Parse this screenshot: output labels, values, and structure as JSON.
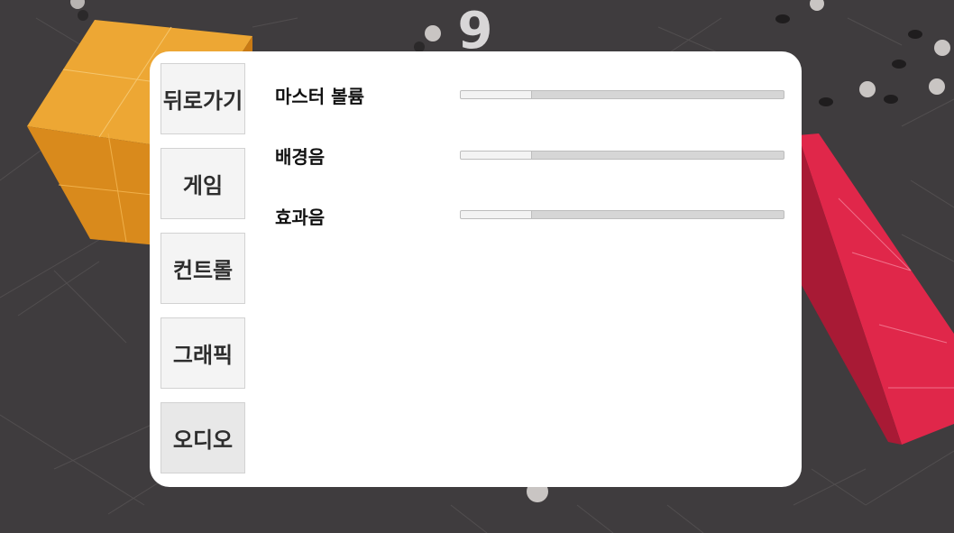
{
  "hud": {
    "score": "9"
  },
  "menu": {
    "items": [
      {
        "label": "뒤로가기"
      },
      {
        "label": "게임"
      },
      {
        "label": "컨트롤"
      },
      {
        "label": "그래픽"
      },
      {
        "label": "오디오",
        "active": true
      }
    ]
  },
  "audio": {
    "settings": [
      {
        "label": "마스터 볼륨",
        "level": 0.22
      },
      {
        "label": "배경음",
        "level": 0.22
      },
      {
        "label": "효과음",
        "level": 0.22
      }
    ]
  },
  "colors": {
    "floor": "#3f3c3e",
    "cube": "#e39a2a",
    "beam": "#e0274a",
    "panel": "#ffffff"
  }
}
